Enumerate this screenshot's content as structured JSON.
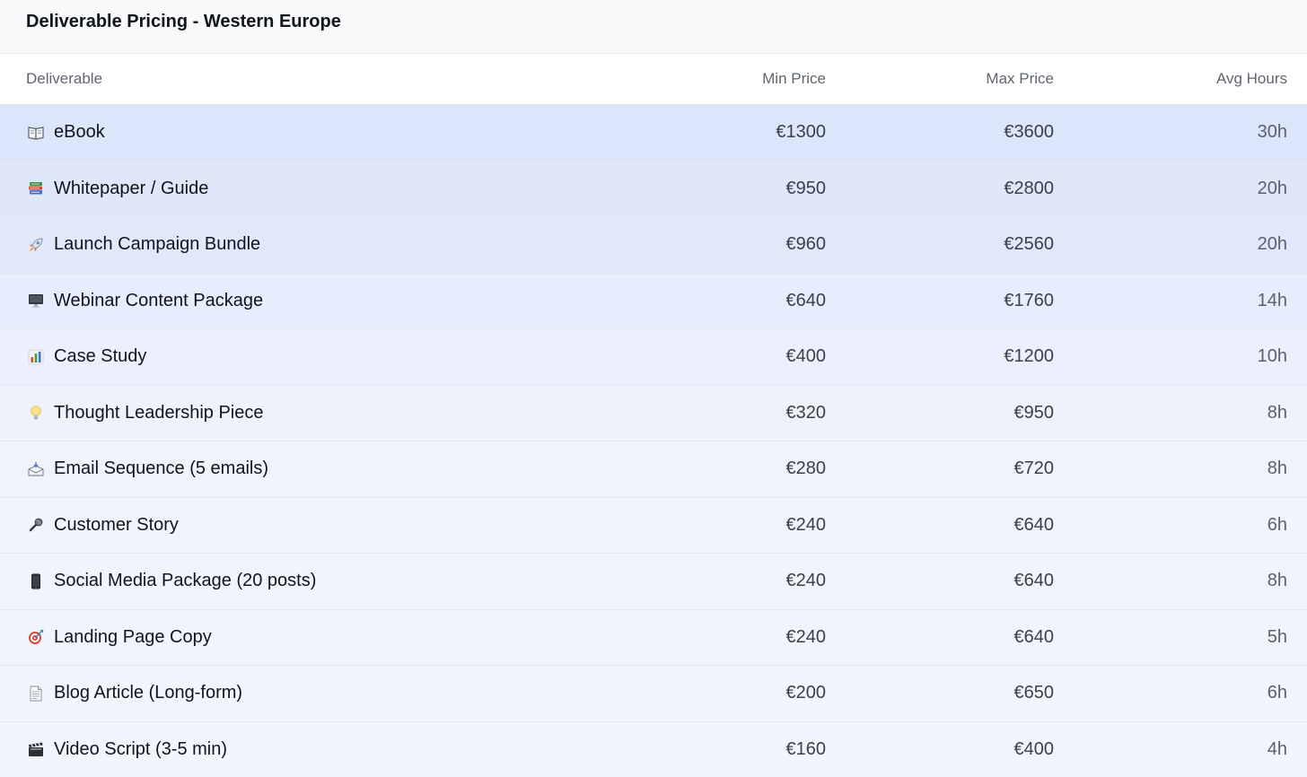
{
  "panel": {
    "title": "Deliverable Pricing - Western Europe"
  },
  "table": {
    "headers": {
      "deliverable": "Deliverable",
      "min_price": "Min Price",
      "max_price": "Max Price",
      "avg_hours": "Avg Hours"
    },
    "rows": [
      {
        "icon": "book-icon",
        "name": "eBook",
        "min": "€1300",
        "max": "€3600",
        "hours": "30h",
        "bg": "#dbe6fb"
      },
      {
        "icon": "books-icon",
        "name": "Whitepaper / Guide",
        "min": "€950",
        "max": "€2800",
        "hours": "20h",
        "bg": "#dfe8fb"
      },
      {
        "icon": "rocket-icon",
        "name": "Launch Campaign Bundle",
        "min": "€960",
        "max": "€2560",
        "hours": "20h",
        "bg": "#e0e9fb"
      },
      {
        "icon": "desktop-computer-icon",
        "name": "Webinar Content Package",
        "min": "€640",
        "max": "€1760",
        "hours": "14h",
        "bg": "#e6edfc"
      },
      {
        "icon": "bar-chart-icon",
        "name": "Case Study",
        "min": "€400",
        "max": "€1200",
        "hours": "10h",
        "bg": "#ebf0fc"
      },
      {
        "icon": "light-bulb-icon",
        "name": "Thought Leadership Piece",
        "min": "€320",
        "max": "€950",
        "hours": "8h",
        "bg": "#edf2fd"
      },
      {
        "icon": "incoming-envelope-icon",
        "name": "Email Sequence (5 emails)",
        "min": "€280",
        "max": "€720",
        "hours": "8h",
        "bg": "#eef3fd"
      },
      {
        "icon": "microphone-icon",
        "name": "Customer Story",
        "min": "€240",
        "max": "€640",
        "hours": "6h",
        "bg": "#f0f4fd"
      },
      {
        "icon": "mobile-phone-icon",
        "name": "Social Media Package (20 posts)",
        "min": "€240",
        "max": "€640",
        "hours": "8h",
        "bg": "#f0f4fd"
      },
      {
        "icon": "target-icon",
        "name": "Landing Page Copy",
        "min": "€240",
        "max": "€640",
        "hours": "5h",
        "bg": "#f0f4fd"
      },
      {
        "icon": "page-document-icon",
        "name": "Blog Article (Long-form)",
        "min": "€200",
        "max": "€650",
        "hours": "6h",
        "bg": "#f1f5fd"
      },
      {
        "icon": "clapper-board-icon",
        "name": "Video Script (3-5 min)",
        "min": "€160",
        "max": "€400",
        "hours": "4h",
        "bg": "#f2f5fd"
      }
    ]
  }
}
